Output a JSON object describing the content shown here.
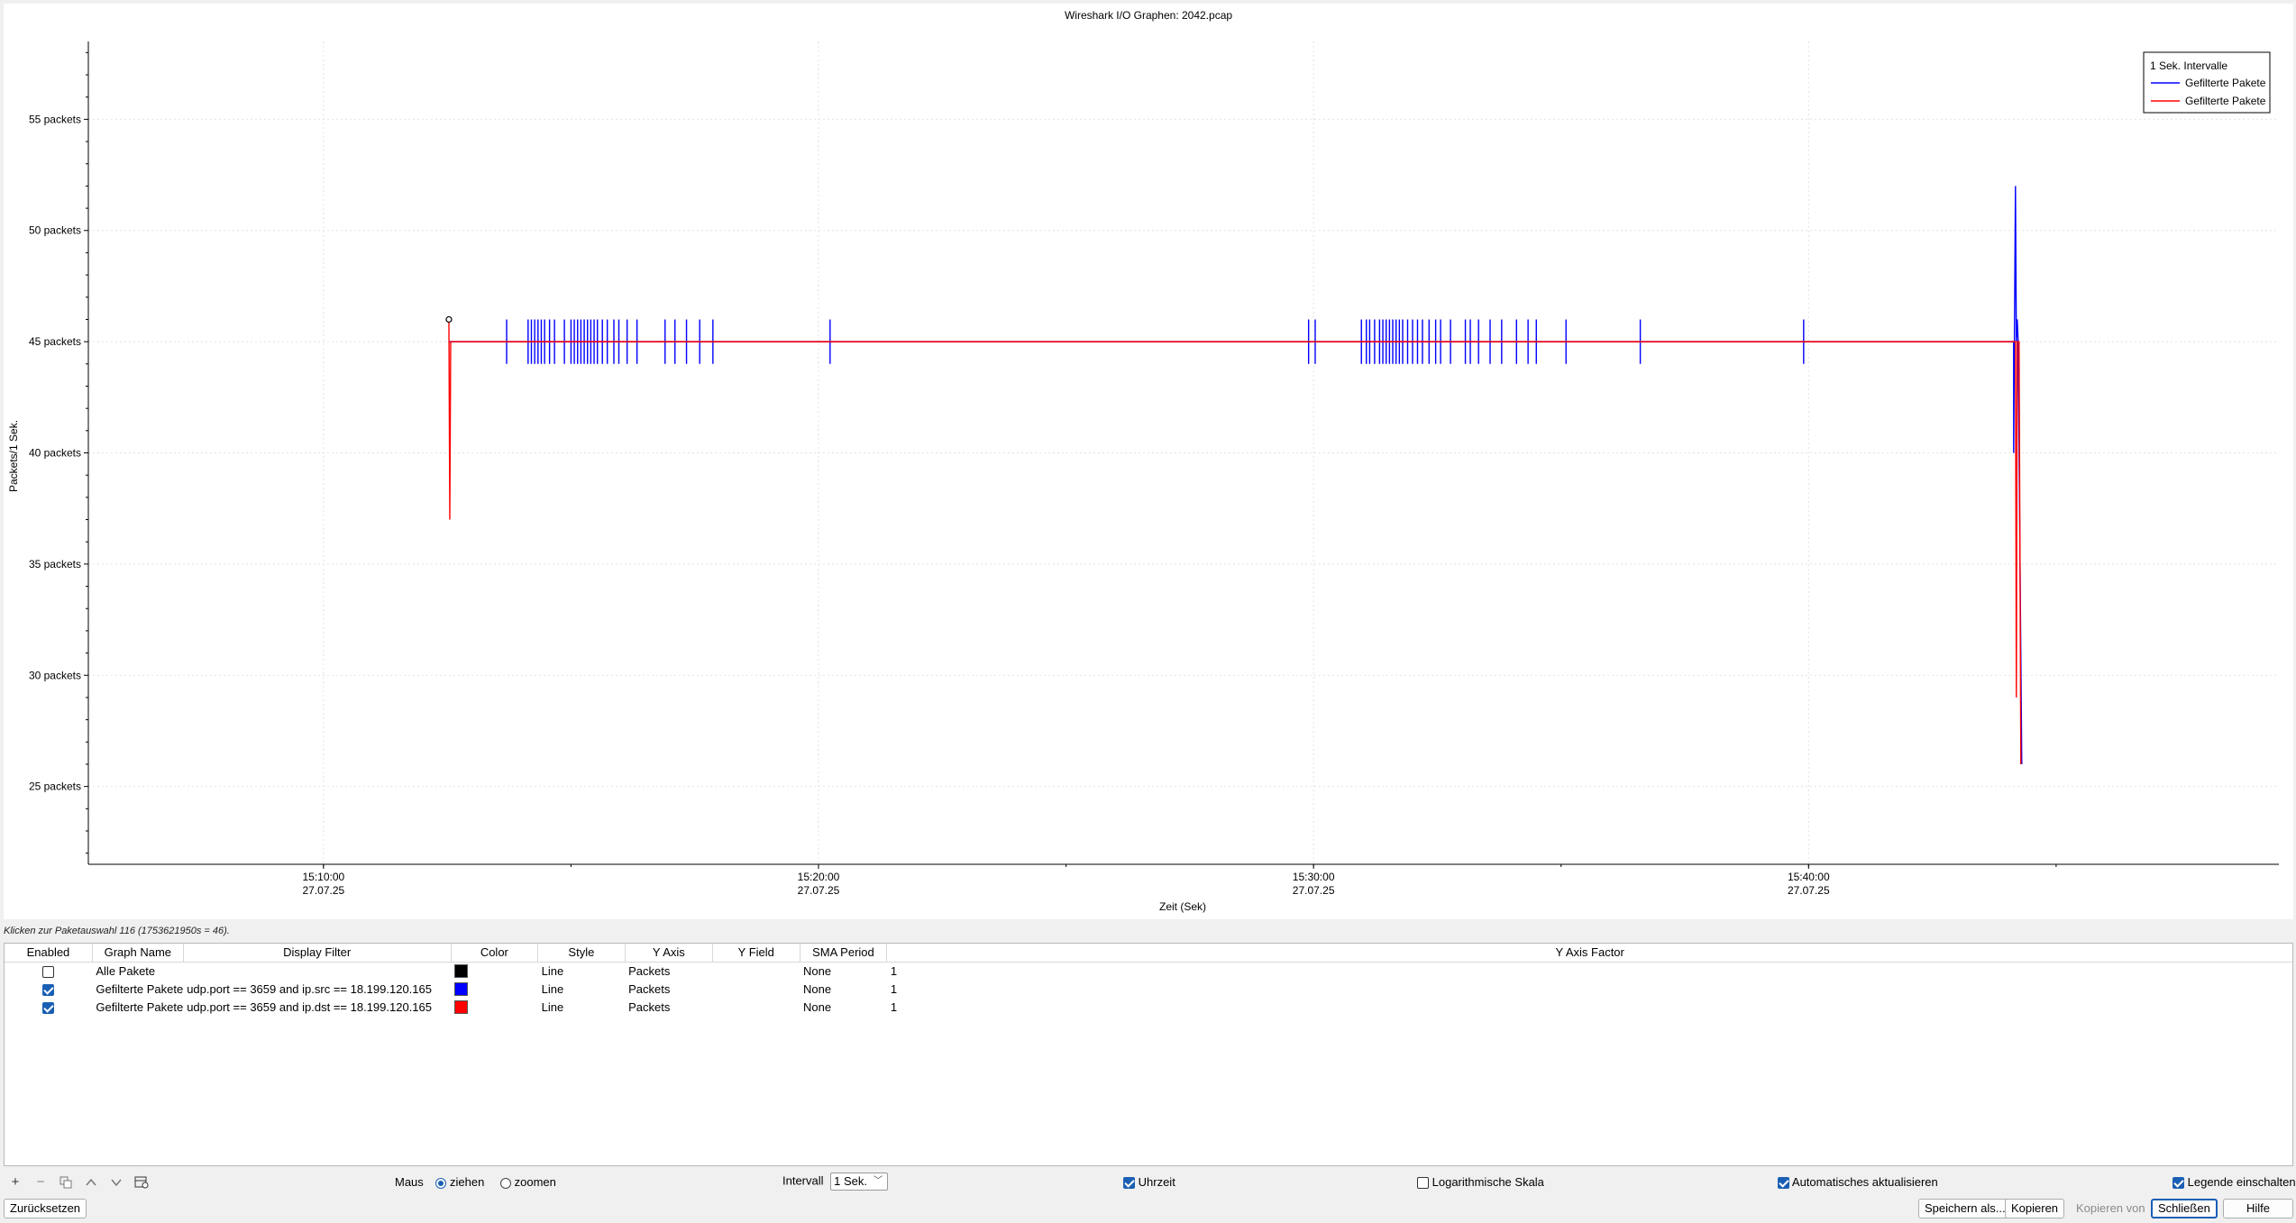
{
  "window": {
    "title": "Wireshark I/O Graphen: 2042.pcap"
  },
  "chart_data": {
    "type": "line",
    "title": "Wireshark I/O Graphen: 2042.pcap",
    "xlabel": "Zeit (Sek)",
    "ylabel": "Packets/1 Sek.",
    "x_ticks": [
      {
        "time": "15:10:00",
        "date": "27.07.25"
      },
      {
        "time": "15:20:00",
        "date": "27.07.25"
      },
      {
        "time": "15:30:00",
        "date": "27.07.25"
      },
      {
        "time": "15:40:00",
        "date": "27.07.25"
      }
    ],
    "x_range": [
      "15:05:15",
      "15:49:30"
    ],
    "y_ticks": [
      "25 packets",
      "30 packets",
      "35 packets",
      "40 packets",
      "45 packets",
      "50 packets",
      "55 packets"
    ],
    "y_tick_values": [
      25,
      30,
      35,
      40,
      45,
      50,
      55
    ],
    "ylim": [
      21.5,
      58.5
    ],
    "grid": true,
    "legend": {
      "position": "top-right",
      "title": "1 Sek. Intervalle",
      "entries": [
        "Gefilterte Pakete",
        "Gefilterte Pakete"
      ]
    },
    "series": [
      {
        "name": "Gefilterte Pakete",
        "color": "#0000ff",
        "baseline": 45,
        "start": "15:12:32",
        "end": "15:44:14",
        "spikes_high": 46,
        "spikes_low": 44,
        "spike_times": [
          "15:13:42",
          "15:14:08",
          "15:14:12",
          "15:14:16",
          "15:14:20",
          "15:14:24",
          "15:14:28",
          "15:14:34",
          "15:14:40",
          "15:14:52",
          "15:15:00",
          "15:15:04",
          "15:15:08",
          "15:15:12",
          "15:15:16",
          "15:15:20",
          "15:15:24",
          "15:15:28",
          "15:15:32",
          "15:15:38",
          "15:15:44",
          "15:15:52",
          "15:15:58",
          "15:16:08",
          "15:16:20",
          "15:16:54",
          "15:17:06",
          "15:17:20",
          "15:17:36",
          "15:17:52",
          "15:20:14",
          "15:29:54",
          "15:30:02",
          "15:30:58",
          "15:31:04",
          "15:31:08",
          "15:31:14",
          "15:31:20",
          "15:31:24",
          "15:31:28",
          "15:31:32",
          "15:31:36",
          "15:31:40",
          "15:31:44",
          "15:31:48",
          "15:31:54",
          "15:32:00",
          "15:32:06",
          "15:32:12",
          "15:32:20",
          "15:32:28",
          "15:32:34",
          "15:32:46",
          "15:33:04",
          "15:33:10",
          "15:33:20",
          "15:33:34",
          "15:33:48",
          "15:34:06",
          "15:34:20",
          "15:34:30",
          "15:35:06",
          "15:36:36",
          "15:39:54"
        ],
        "end_spike_high": 52,
        "end_spike_low": 40
      },
      {
        "name": "Gefilterte Pakete",
        "color": "#ff0000",
        "baseline": 45,
        "start": "15:12:32",
        "end": "15:44:14",
        "start_spike": [
          46,
          37
        ],
        "end_spike_low": 26
      }
    ],
    "marker": {
      "time": "15:12:32",
      "value": 46
    }
  },
  "status": "Klicken zur Paketauswahl 116 (1753621950s = 46).",
  "table": {
    "headers": [
      "Enabled",
      "Graph Name",
      "Display Filter",
      "Color",
      "Style",
      "Y Axis",
      "Y Field",
      "SMA Period",
      "Y Axis Factor"
    ],
    "rows": [
      {
        "enabled": false,
        "name": "Alle Pakete",
        "filter": "",
        "color": "#000000",
        "style": "Line",
        "y_axis": "Packets",
        "y_field": "",
        "sma": "None",
        "factor": "1"
      },
      {
        "enabled": true,
        "name": "Gefilterte Pakete",
        "filter": "udp.port == 3659 and ip.src == 18.199.120.165",
        "color": "#0000ff",
        "style": "Line",
        "y_axis": "Packets",
        "y_field": "",
        "sma": "None",
        "factor": "1"
      },
      {
        "enabled": true,
        "name": "Gefilterte Pakete",
        "filter": "udp.port == 3659 and ip.dst  == 18.199.120.165",
        "color": "#ff0000",
        "style": "Line",
        "y_axis": "Packets",
        "y_field": "",
        "sma": "None",
        "factor": "1"
      }
    ]
  },
  "toolbar": {
    "mouse_label": "Maus",
    "drag_label": "ziehen",
    "zoom_label": "zoomen",
    "mouse_mode": "ziehen",
    "interval_label": "Intervall",
    "interval_value": "1 Sek.",
    "time_of_day_label": "Uhrzeit",
    "time_of_day": true,
    "log_scale_label": "Logarithmische Skala",
    "log_scale": false,
    "auto_update_label": "Automatisches aktualisieren",
    "auto_update": true,
    "legend_label": "Legende einschalten",
    "legend_on": true
  },
  "buttons": {
    "reset": "Zurücksetzen",
    "save_as": "Speichern als...",
    "copy": "Kopieren",
    "copy_from": "Kopieren von",
    "close": "Schließen",
    "help": "Hilfe"
  }
}
